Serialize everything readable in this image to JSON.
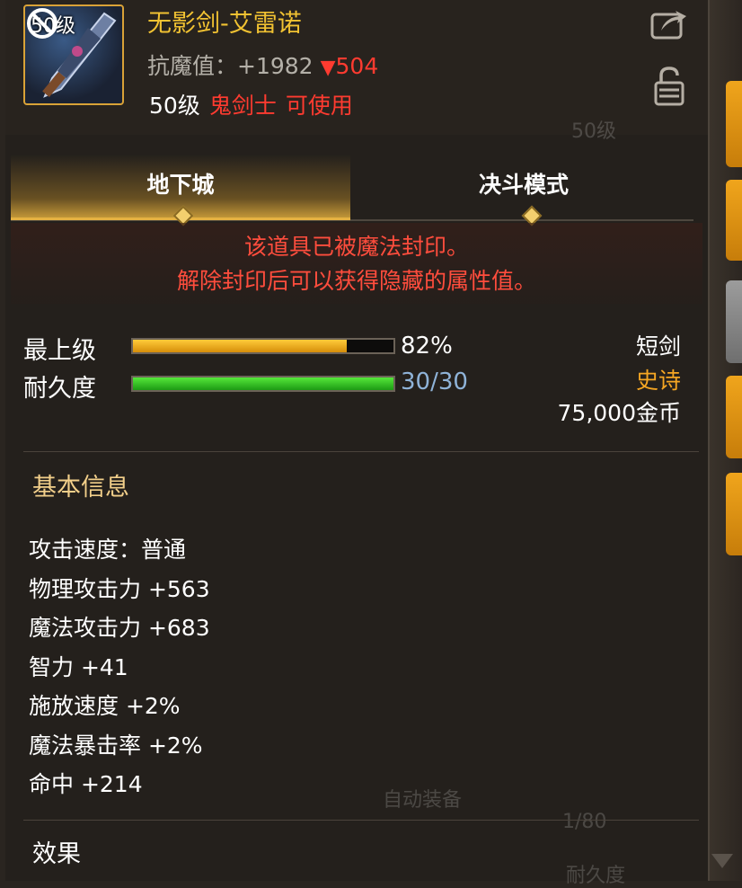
{
  "item": {
    "icon_level": "50级",
    "name": "无影剑-艾雷诺",
    "resist_label": "抗魔值：",
    "resist_value": "+1982",
    "resist_change": "504",
    "req_level": "50级",
    "req_class": "鬼剑士",
    "req_usable": "可使用"
  },
  "tabs": [
    {
      "label": "地下城",
      "active": true
    },
    {
      "label": "决斗模式",
      "active": false
    }
  ],
  "seal_notice": {
    "line1": "该道具已被魔法封印。",
    "line2": "解除封印后可以获得隐藏的属性值。"
  },
  "bars": {
    "grade": {
      "label": "最上级",
      "value_text": "82%",
      "fill": 0.82
    },
    "durability": {
      "label": "耐久度",
      "value_text": "30/30",
      "fill": 1.0
    }
  },
  "info_right": {
    "type": "短剑",
    "rarity": "史诗",
    "price": "75,000金币"
  },
  "basic_info": {
    "title": "基本信息",
    "lines": [
      "攻击速度：普通",
      "物理攻击力 +563",
      "魔法攻击力 +683",
      "智力 +41",
      "施放速度 +2%",
      "魔法暴击率 +2%",
      "命中 +214"
    ]
  },
  "effect_title": "效果",
  "background": {
    "auto_equip": "自动装备",
    "count": "1/80",
    "durability": "耐久度",
    "label_50": "50级"
  },
  "colors": {
    "item_name": "#f1c232",
    "warning_red": "#ff3b30",
    "rarity_epic": "#f5a623",
    "durability_value": "#8fb3d8",
    "section_title": "#f2cf8a"
  }
}
